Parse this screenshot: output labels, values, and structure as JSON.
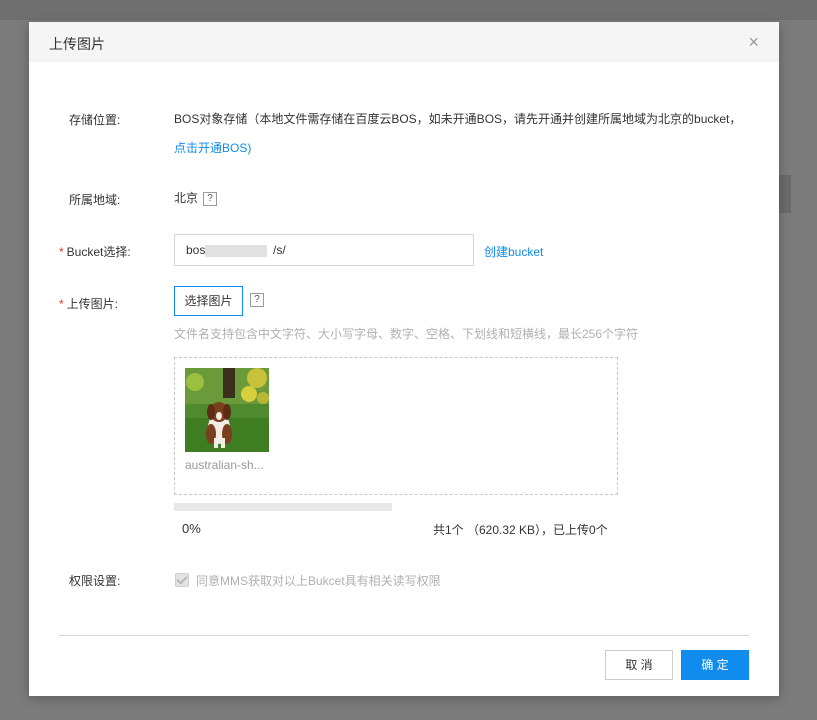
{
  "dialog": {
    "title": "上传图片",
    "close_glyph": "×"
  },
  "storage": {
    "label": "存储位置:",
    "text": "BOS对象存储（本地文件需存储在百度云BOS，如未开通BOS，请先开通并创建所属地域为北京的bucket，",
    "link": "点击开通BOS",
    "close_paren": ")"
  },
  "region": {
    "label": "所属地域:",
    "value": "北京",
    "help_glyph": "?"
  },
  "bucket": {
    "required_mark": "*",
    "label": "Bucket选择:",
    "value_prefix": "bos",
    "value_suffix": "/s/",
    "create_link": "创建bucket"
  },
  "upload": {
    "required_mark": "*",
    "label": "上传图片:",
    "choose_button": "选择图片",
    "help_glyph": "?",
    "hint": "文件名支持包含中文字符、大小写字母、数字、空格、下划线和短横线，最长256个字符",
    "file_name": "australian-sh...",
    "progress_percent_text": "0%",
    "progress_fraction": 0,
    "summary": "共1个 （620.32 KB），已上传0个"
  },
  "permission": {
    "label": "权限设置:",
    "checkbox_label": "同意MMS获取对以上Bukcet具有相关读写权限",
    "checked": true
  },
  "footer": {
    "cancel_label": "取 消",
    "ok_label": "确 定"
  },
  "colors": {
    "accent": "#108cee",
    "required": "#e0322b",
    "overlay": "#7b7b7b"
  }
}
